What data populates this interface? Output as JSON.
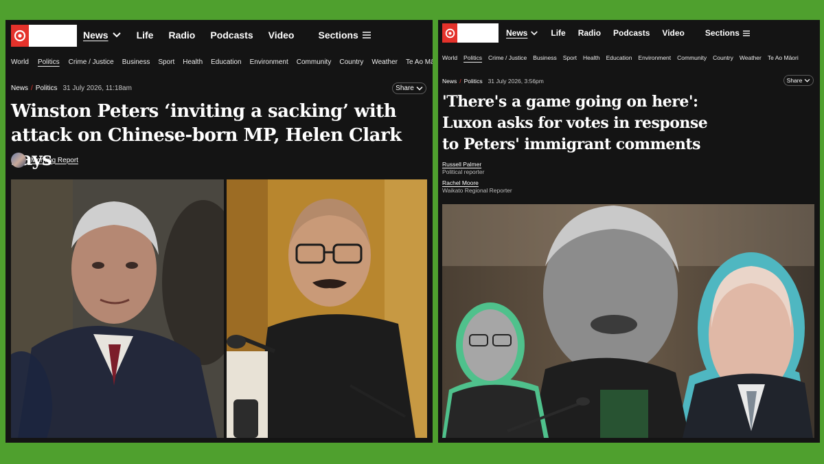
{
  "colors": {
    "background": "#4fa02e",
    "panel": "#141414",
    "brand_red": "#e4322b"
  },
  "left_article": {
    "nav": {
      "items": [
        "News",
        "Life",
        "Radio",
        "Podcasts",
        "Video"
      ],
      "sections_label": "Sections"
    },
    "subnav": [
      "World",
      "Politics",
      "Crime / Justice",
      "Business",
      "Sport",
      "Health",
      "Education",
      "Environment",
      "Community",
      "Country",
      "Weather",
      "Te Ao Māori"
    ],
    "breadcrumb": {
      "section": "News",
      "separator": "/",
      "subsection": "Politics",
      "date": "31 July 2026, 11:18am"
    },
    "share_label": "Share",
    "headline": "Winston Peters ‘inviting a sacking’ with attack on Chinese-born MP, Helen Clark says",
    "byline": "Morning Report"
  },
  "right_article": {
    "nav": {
      "items": [
        "News",
        "Life",
        "Radio",
        "Podcasts",
        "Video"
      ],
      "sections_label": "Sections"
    },
    "subnav": [
      "World",
      "Politics",
      "Crime / Justice",
      "Business",
      "Sport",
      "Health",
      "Education",
      "Environment",
      "Community",
      "Country",
      "Weather",
      "Te Ao Māori"
    ],
    "breadcrumb": {
      "section": "News",
      "separator": "/",
      "subsection": "Politics",
      "date": "31 July 2026, 3:56pm"
    },
    "share_label": "Share",
    "headline": "'There's a game going on here': Luxon asks for votes in response to Peters' immigrant comments",
    "authors": [
      {
        "name": "Russell Palmer",
        "role": "Political reporter"
      },
      {
        "name": "Rachel Moore",
        "role": "Waikato Regional Reporter"
      }
    ]
  }
}
